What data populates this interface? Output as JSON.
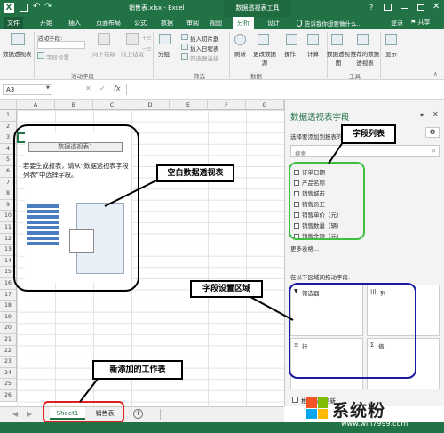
{
  "app": {
    "window_title": "销售表.xlsx - Excel",
    "context_tab_group": "数据透视表工具",
    "login": "登录",
    "share": "共享"
  },
  "tabs": [
    "文件",
    "开始",
    "插入",
    "页面布局",
    "公式",
    "数据",
    "审阅",
    "视图",
    "分析",
    "设计"
  ],
  "tell_me": "告诉我你想要做什么...",
  "ribbon": {
    "pivot_group_btn": "数据透视表",
    "active_field_label": "活动字段:",
    "field_settings": "字段设置",
    "drill_down": "向下钻取",
    "drill_up": "向上钻取",
    "active_field_group": "活动字段",
    "group_btn": "分组",
    "insert_slicer": "插入切片器",
    "insert_timeline": "插入日程表",
    "filter_connections": "筛选器连接",
    "filter_group": "筛选",
    "refresh": "刷新",
    "change_source": "更改数据源",
    "data_group": "数据",
    "actions": "操作",
    "calculations": "计算",
    "pivot_chart": "数据透视图",
    "recommended": "推荐的数据透视表",
    "tools_group": "工具",
    "show": "显示"
  },
  "name_box": "A3",
  "columns": [
    "A",
    "B",
    "C",
    "D",
    "E",
    "F",
    "G"
  ],
  "rows": [
    "1",
    "2",
    "3",
    "4",
    "5",
    "6",
    "7",
    "8",
    "9",
    "10",
    "11",
    "12",
    "13",
    "14",
    "15",
    "16",
    "17",
    "18",
    "19",
    "20",
    "21",
    "22",
    "23",
    "24",
    "25",
    "26"
  ],
  "placeholder": {
    "title": "数据透视表1",
    "instructions": "若要生成报表，请从“数据透视表字段列表”中选择字段。"
  },
  "pane": {
    "title": "数据透视表字段",
    "choose_fields": "选择要添加到报表的字段:",
    "search": "搜索",
    "fields": [
      "订单日期",
      "产品名称",
      "销售城市",
      "销售员工",
      "销售单价（元）",
      "销售数量（辆）",
      "销售金额（元）"
    ],
    "more_tables": "更多表格...",
    "drag_label": "在以下区域间拖动字段:",
    "area_filters": "筛选器",
    "area_columns": "列",
    "area_rows": "行",
    "area_values": "值",
    "defer_update": "推迟布局更新"
  },
  "sheets": [
    "Sheet1",
    "销售表"
  ],
  "annotations": {
    "blank_pivot": "空白数据透视表",
    "field_list": "字段列表",
    "field_areas": "字段设置区域",
    "new_sheet": "新添加的工作表"
  },
  "watermark": {
    "brand": "系统粉",
    "url": "www.win7999.com"
  },
  "colors": {
    "excel_green": "#217346",
    "annotation_green": "#3fbf3f",
    "annotation_blue": "#1a1aa0",
    "annotation_red": "#e02020",
    "pivot_tab_bg": "#c2e0c8"
  }
}
